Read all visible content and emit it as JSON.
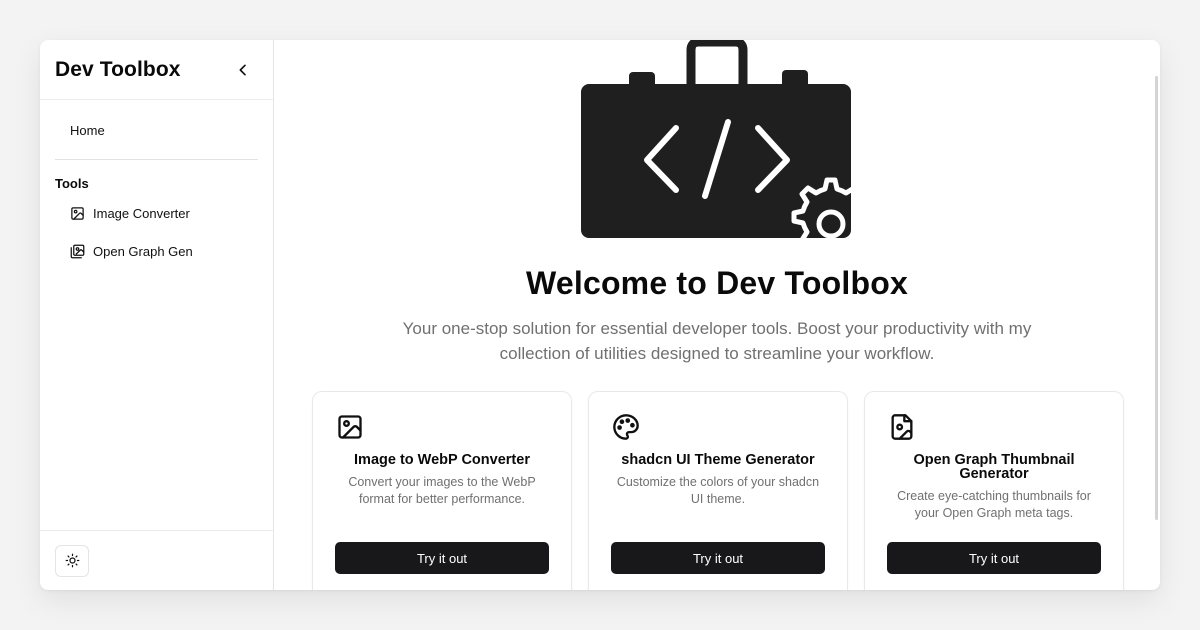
{
  "sidebar": {
    "title": "Dev Toolbox",
    "home_label": "Home",
    "section_label": "Tools",
    "items": [
      {
        "label": "Image Converter",
        "icon": "image-icon"
      },
      {
        "label": "Open Graph Gen",
        "icon": "images-icon"
      }
    ],
    "theme_toggle_icon": "sun-icon"
  },
  "hero": {
    "logo_icon": "toolbox-code-icon",
    "title": "Welcome to Dev Toolbox",
    "subtitle": "Your one-stop solution for essential developer tools. Boost your productivity with my collection of utilities designed to streamline your workflow."
  },
  "cards": [
    {
      "icon": "image-icon",
      "title": "Image to WebP Converter",
      "description": "Convert your images to the WebP format for better performance.",
      "button_label": "Try it out"
    },
    {
      "icon": "palette-icon",
      "title": "shadcn UI Theme Generator",
      "description": "Customize the colors of your shadcn UI theme.",
      "button_label": "Try it out"
    },
    {
      "icon": "file-image-icon",
      "title": "Open Graph Thumbnail Generator",
      "description": "Create eye-catching thumbnails for your Open Graph meta tags.",
      "button_label": "Try it out"
    }
  ],
  "colors": {
    "accent": "#18181b",
    "muted_text": "#707070",
    "border": "#e5e5e5",
    "page_background": "#f3f3f4"
  }
}
